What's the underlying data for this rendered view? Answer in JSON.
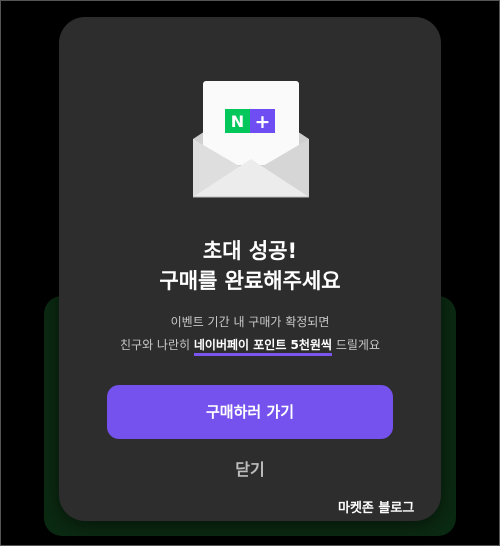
{
  "modal": {
    "title_line1": "초대 성공!",
    "title_line2": "구매를 완료해주세요",
    "desc_line1": "이벤트 기간 내 구매가 확정되면",
    "desc_line2_prefix": "친구와 나란히 ",
    "desc_line2_highlight": "네이버페이 포인트 5천원씩",
    "desc_line2_suffix": " 드릴게요",
    "primary_button": "구매하러 가기",
    "close_button": "닫기",
    "badge_n": "N",
    "badge_plus": "+"
  },
  "watermark": "마켓존 블로그",
  "colors": {
    "accent": "#7552ee",
    "modal_bg": "#2d2d2d",
    "badge_green": "#03c75a",
    "badge_purple": "#6e4ef2",
    "page_bg": "#000000",
    "background_card": "#0b2a12"
  },
  "icons": [
    "envelope-icon",
    "naver-plus-icon"
  ]
}
